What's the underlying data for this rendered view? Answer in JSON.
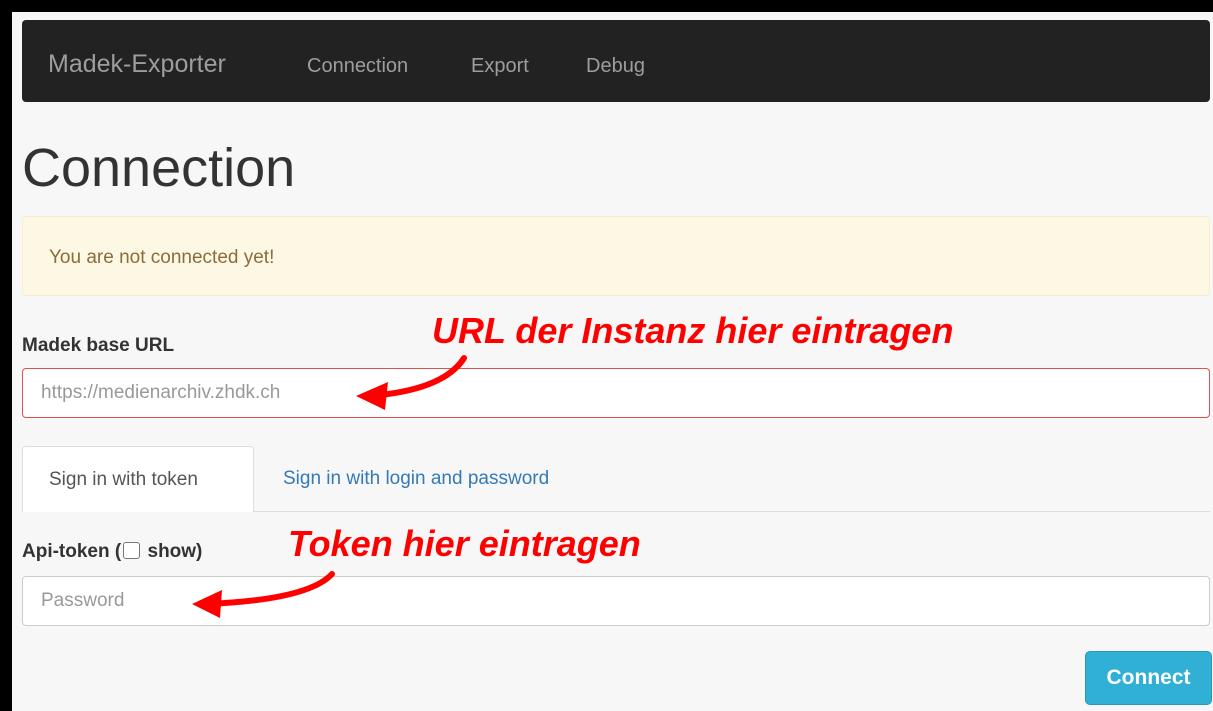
{
  "navbar": {
    "brand": "Madek-Exporter",
    "links": [
      "Connection",
      "Export",
      "Debug"
    ]
  },
  "page": {
    "title": "Connection",
    "alert": "You are not connected yet!"
  },
  "form": {
    "url_label": "Madek base URL",
    "url_placeholder": "https://medienarchiv.zhdk.ch",
    "tabs": [
      "Sign in with token",
      "Sign in with login and password"
    ],
    "token_label_prefix": "Api-token (",
    "token_label_suffix": " show)",
    "token_placeholder": "Password",
    "connect_label": "Connect"
  },
  "annotations": {
    "url_hint": "URL der Instanz hier eintragen",
    "token_hint": "Token hier eintragen",
    "color": "#ff0000"
  }
}
